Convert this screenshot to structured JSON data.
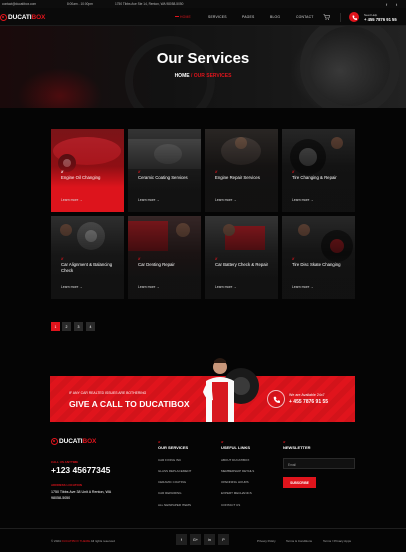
{
  "topbar": {
    "email": "contact@ducatibox.com",
    "hours": "8:00am - 10:00pm",
    "address": "1750 Tibbs Ave Ste 14, Renton, WA 98058-5050",
    "social": [
      "f",
      "t"
    ]
  },
  "nav": {
    "logo_main": "DUCATI",
    "logo_accent": "BOX",
    "menu": [
      "HOME",
      "SERVICES",
      "PAGES",
      "BLOG",
      "CONTACT"
    ],
    "active_index": 0,
    "phone_label": "Need Help",
    "phone": "+ 455 7876 91 55"
  },
  "hero": {
    "title": "Our Services",
    "breadcrumb_home": "HOME",
    "breadcrumb_sep": "/",
    "breadcrumb_current": "OUR SERVICES"
  },
  "services": [
    {
      "title": "Engine Oil Changing",
      "more": "Learn more",
      "active": true
    },
    {
      "title": "Ceramic Coating Services",
      "more": "Learn more",
      "active": false
    },
    {
      "title": "Engine Repair Services",
      "more": "Learn more",
      "active": false
    },
    {
      "title": "Tire Changing & Repair",
      "more": "Learn more",
      "active": false
    },
    {
      "title": "Car Alignment & Balancing Check",
      "more": "Learn more",
      "active": false
    },
    {
      "title": "Car Denting Repair",
      "more": "Learn more",
      "active": false
    },
    {
      "title": "Car Battery Check & Repair",
      "more": "Learn more",
      "active": false
    },
    {
      "title": "Tire Disc Skate Changing",
      "more": "Learn more",
      "active": false
    }
  ],
  "pagination": {
    "pages": [
      "1",
      "2",
      "3",
      "4"
    ],
    "current": "1"
  },
  "cta": {
    "small": "IF ANY CAR REALTED ISSUES ARE BOTHERING",
    "big": "GIVE A CALL TO DUCATIBOX",
    "phone_label": "We are Available 24x7",
    "phone": "+ 455 7876 91 55"
  },
  "footer": {
    "call_label": "CALL US ANYTIME",
    "phone": "+123 45677345",
    "address_label": "ADDRESS LOCATION",
    "address": "1750 Tibbs Ave 38 Unit A Renton, WA 98058-5050",
    "services_head": "OUR SERVICES",
    "services": [
      "CAR FIXING INC",
      "GLASS REPLACEMENT",
      "CERAMIC COATING",
      "CAR REPAIRING",
      "ALL NEWPAPER ITEMS"
    ],
    "useful_head": "USEFUL LINKS",
    "useful": [
      "ABOUT DUCATIBOX",
      "MEMBERSHIP DETAILS",
      "OPENNING HOURS",
      "EXPERT MECHANICS",
      "CONTACT US"
    ],
    "newsletter_head": "NEWSLETTER",
    "email_placeholder": "Email",
    "subscribe": "SUBSCRIBE",
    "copyright_pre": "© 2024",
    "copyright_brand": "DUCATIBOX THEME",
    "copyright_post": "All rights reserved",
    "social": [
      "f",
      "G+",
      "in",
      "P"
    ],
    "legal": [
      "Privacy Policy",
      "Terms & Conditions",
      "Terms / Privacy Apps"
    ]
  },
  "colors": {
    "accent": "#e0141c",
    "background": "#050505",
    "card": "#1b1b1b"
  }
}
